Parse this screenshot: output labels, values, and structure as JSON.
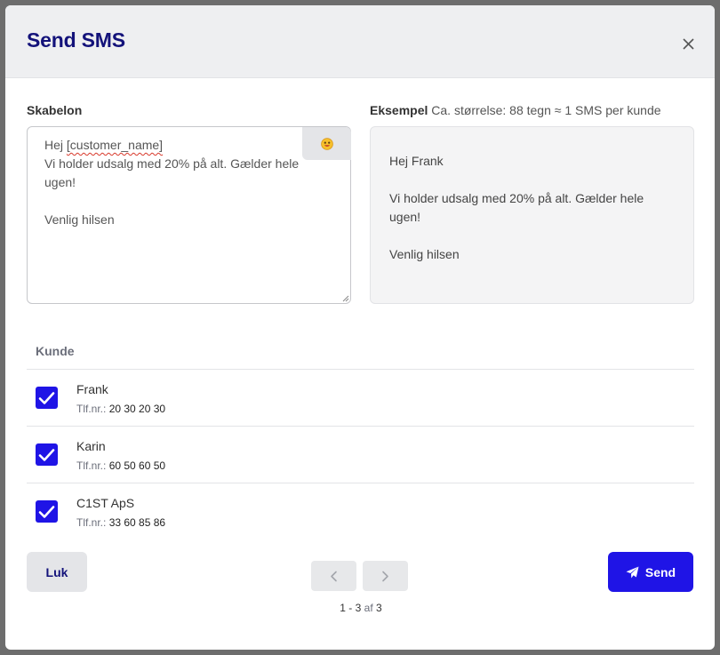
{
  "modal": {
    "title": "Send SMS"
  },
  "template": {
    "label": "Skabelon",
    "greeting": "Hej ",
    "placeholder_token": "[customer_name]",
    "body": "\nVi holder udsalg med 20% på alt. Gælder hele ugen!\n\nVenlig hilsen"
  },
  "preview": {
    "label": "Eksempel",
    "meta": "Ca. størrelse: 88 tegn ≈ 1 SMS per kunde",
    "text": "Hej Frank\n\nVi holder udsalg med 20% på alt. Gælder hele ugen!\n\nVenlig hilsen"
  },
  "table": {
    "column_label": "Kunde",
    "phone_label": "Tlf.nr.:",
    "rows": [
      {
        "name": "Frank",
        "phone": "20 30 20 30",
        "checked": true
      },
      {
        "name": "Karin",
        "phone": "60 50 60 50",
        "checked": true
      },
      {
        "name": "C1ST ApS",
        "phone": "33 60 85 86",
        "checked": true
      }
    ]
  },
  "pagination": {
    "range": "1 - 3",
    "of_word": "af",
    "total": "3"
  },
  "buttons": {
    "close_label": "Luk",
    "send_label": "Send"
  },
  "colors": {
    "accent": "#1f14e6",
    "title": "#13127a"
  },
  "icons": [
    "close-icon",
    "emoji-icon",
    "checkmark-icon",
    "chevron-left-icon",
    "chevron-right-icon",
    "paper-plane-icon"
  ]
}
